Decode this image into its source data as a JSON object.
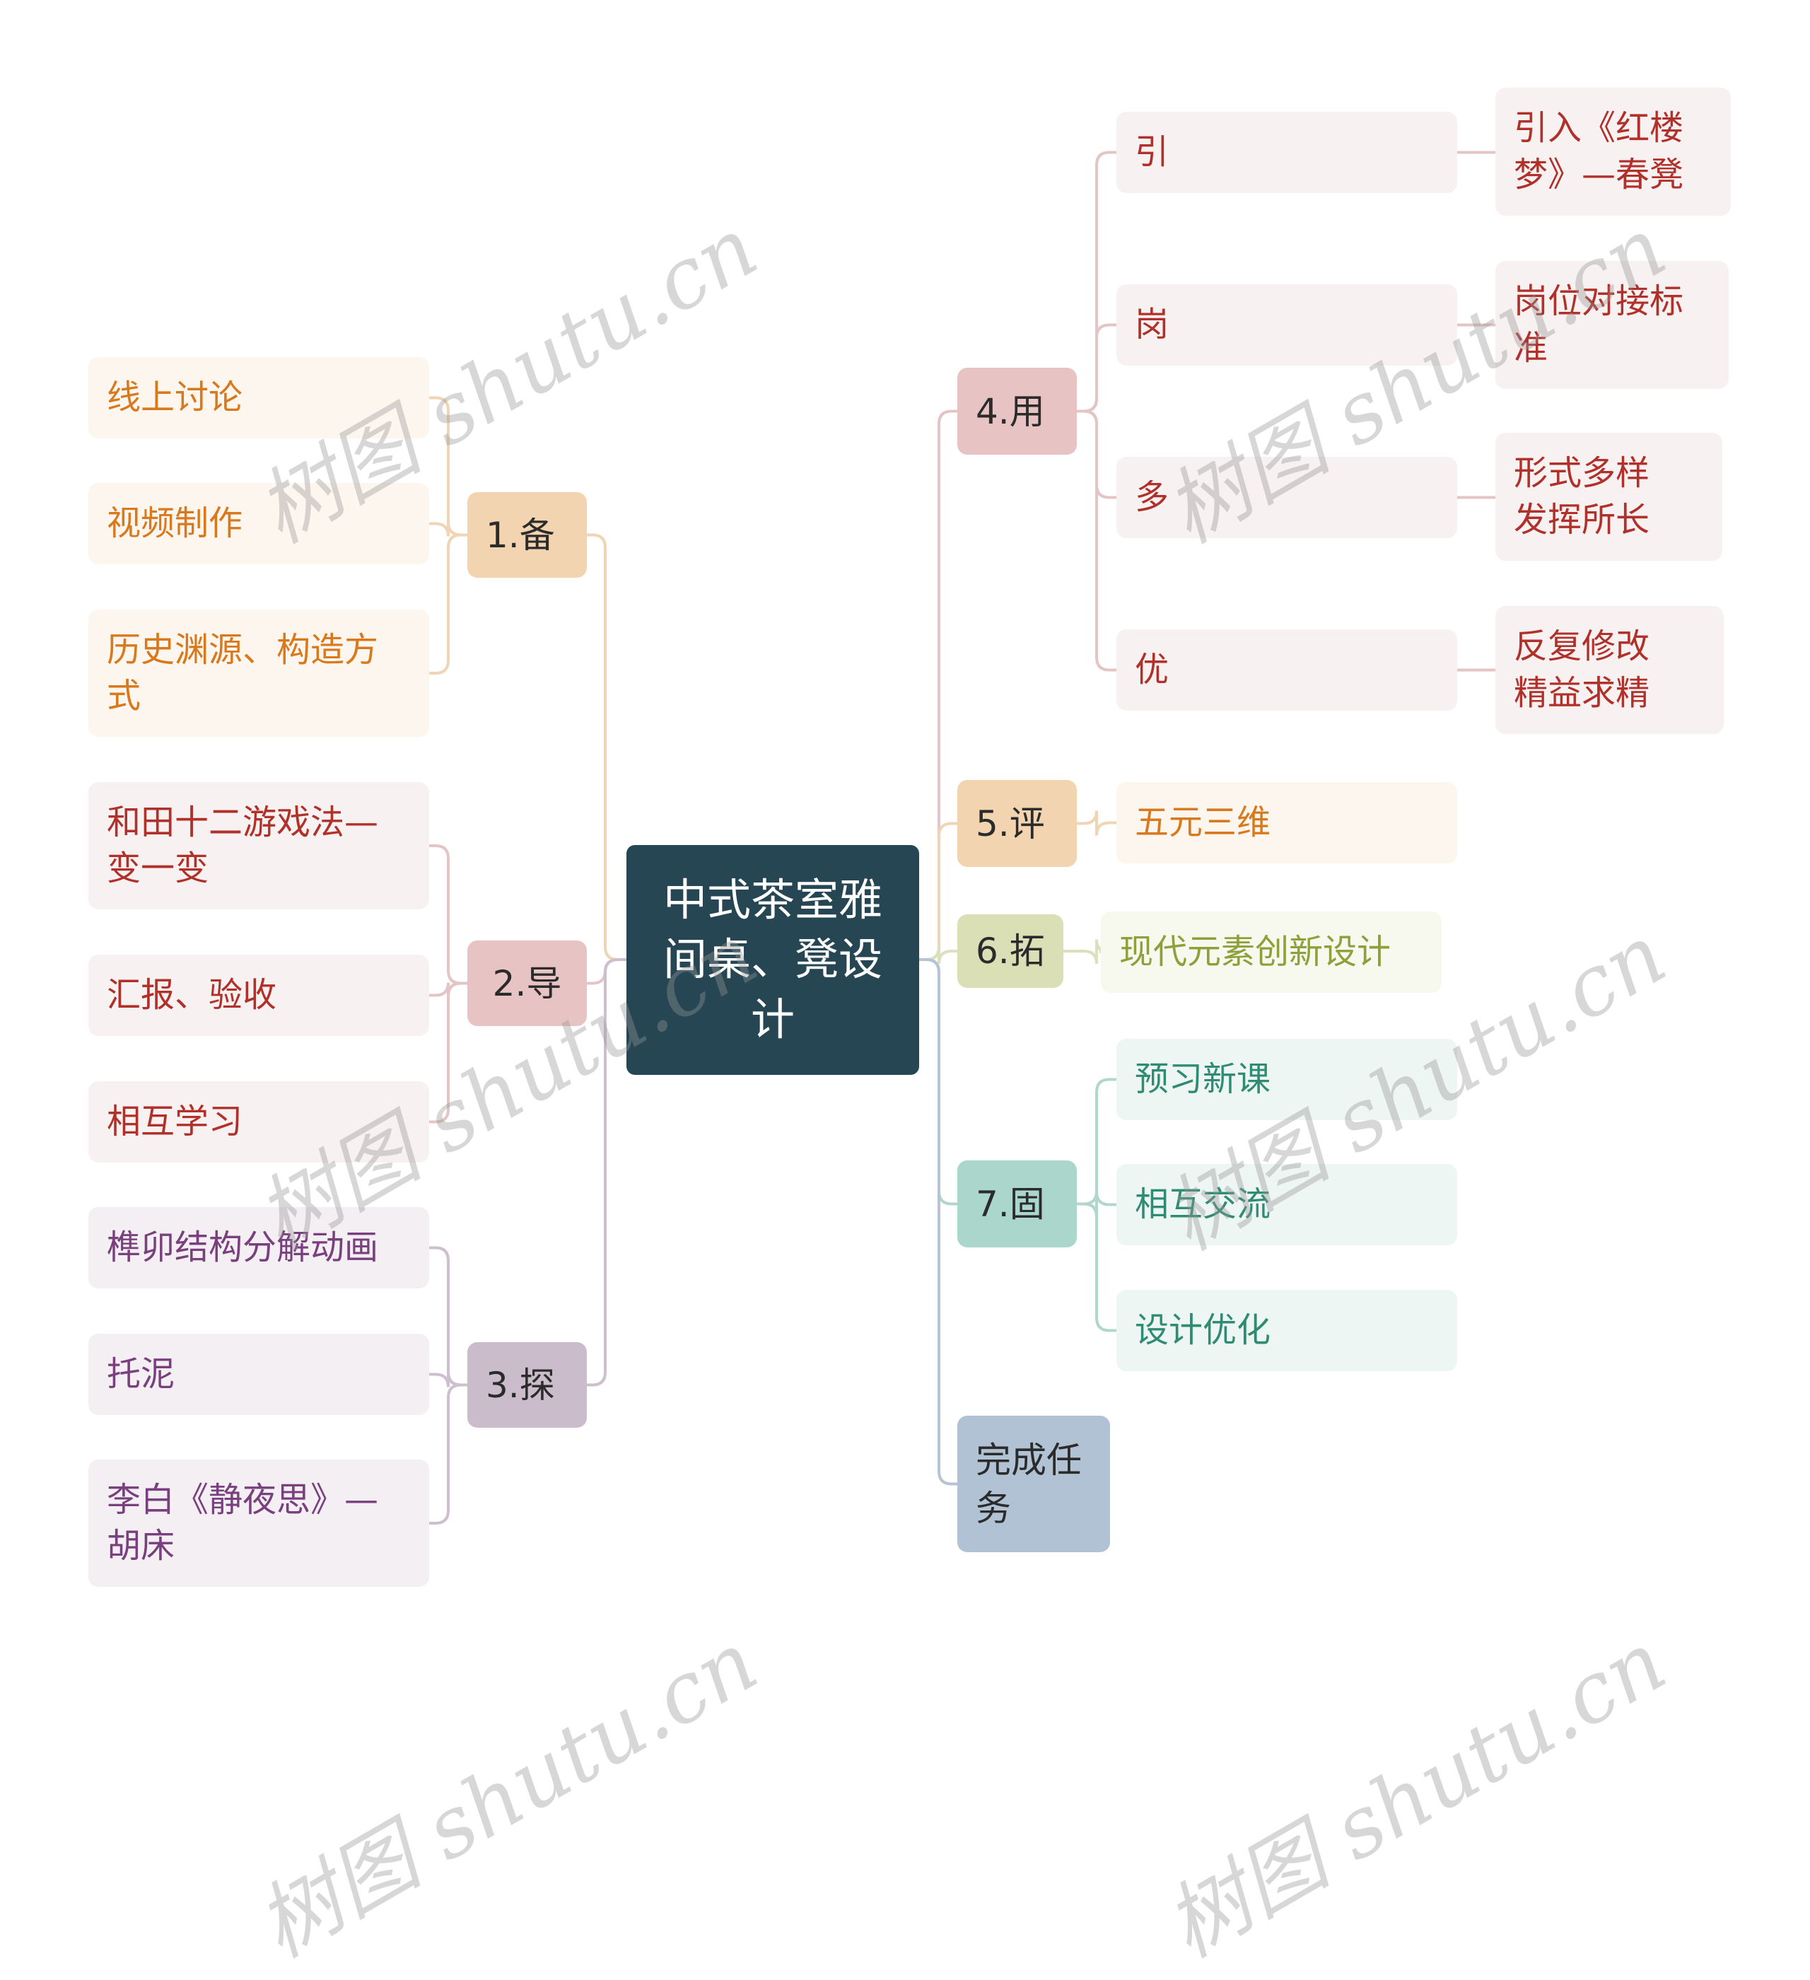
{
  "root": {
    "label": "中式茶室雅\n间桌、凳设\n计",
    "color": "#264653"
  },
  "branches": [
    {
      "id": "b1",
      "label": "1.备",
      "fill": "#f2d4b0",
      "line": "#efd5b5",
      "leaf_bg": "#fdf6ee",
      "leaf_text": "#d9791d",
      "children": [
        {
          "label": "线上讨论"
        },
        {
          "label": "视频制作"
        },
        {
          "label": "历史渊源、构造方\n式"
        }
      ]
    },
    {
      "id": "b2",
      "label": "2.导",
      "fill": "#e7c3c3",
      "line": "#e4c4c4",
      "leaf_bg": "#f8f1f1",
      "leaf_text": "#b0302a",
      "children": [
        {
          "label": "和田十二游戏法—\n变一变"
        },
        {
          "label": "汇报、验收"
        },
        {
          "label": "相互学习"
        }
      ]
    },
    {
      "id": "b3",
      "label": "3.探",
      "fill": "#cbbccb",
      "line": "#cdbfcd",
      "leaf_bg": "#f3eff3",
      "leaf_text": "#7a3f7e",
      "children": [
        {
          "label": "榫卯结构分解动画"
        },
        {
          "label": "托泥"
        },
        {
          "label": "李白《静夜思》—\n胡床"
        }
      ]
    },
    {
      "id": "b4",
      "label": "4.用",
      "fill": "#e7c3c3",
      "line": "#e4c4c4",
      "leaf_bg": "#f8f1f1",
      "leaf_text": "#b0302a",
      "children": [
        {
          "label": "引",
          "detail": "引入《红楼\n梦》—春凳"
        },
        {
          "label": "岗",
          "detail": "岗位对接标\n准"
        },
        {
          "label": "多",
          "detail": "形式多样\n发挥所长"
        },
        {
          "label": "优",
          "detail": "反复修改\n精益求精"
        }
      ]
    },
    {
      "id": "b5",
      "label": "5.评",
      "fill": "#f2d4b0",
      "line": "#efd5b5",
      "leaf_bg": "#fdf6ee",
      "leaf_text": "#d9791d",
      "children": [
        {
          "label": "五元三维"
        }
      ]
    },
    {
      "id": "b6",
      "label": "6.拓",
      "fill": "#dbdfb5",
      "line": "#dbe0bd",
      "leaf_bg": "#f7f8ee",
      "leaf_text": "#8ea03a",
      "children": [
        {
          "label": "现代元素创新设计"
        }
      ]
    },
    {
      "id": "b7",
      "label": "7.固",
      "fill": "#abd6cc",
      "line": "#b0d6cd",
      "leaf_bg": "#eef6f4",
      "leaf_text": "#2f8c72",
      "children": [
        {
          "label": "预习新课"
        },
        {
          "label": "相互交流"
        },
        {
          "label": "设计优化"
        }
      ]
    },
    {
      "id": "b8",
      "label": "完成任\n务",
      "fill": "#b1c2d4",
      "line": "#b5c3d4",
      "children": []
    }
  ],
  "watermark": "树图 shutu.cn"
}
